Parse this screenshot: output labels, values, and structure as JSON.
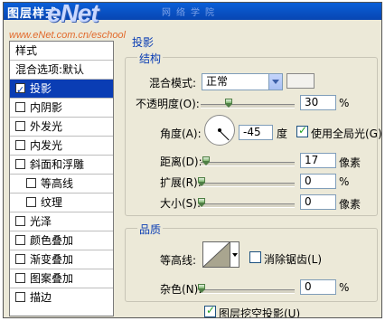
{
  "window": {
    "title": "图层样式"
  },
  "watermark": {
    "logo": "eNet",
    "cn": "网络学院",
    "url": "www.eNet.com.cn/eschool"
  },
  "sidebar": {
    "header": "样式",
    "blend_options": "混合选项:默认",
    "items": [
      {
        "label": "投影",
        "checked": true,
        "selected": true
      },
      {
        "label": "内阴影",
        "checked": false
      },
      {
        "label": "外发光",
        "checked": false
      },
      {
        "label": "内发光",
        "checked": false
      },
      {
        "label": "斜面和浮雕",
        "checked": false
      },
      {
        "label": "等高线",
        "checked": false
      },
      {
        "label": "纹理",
        "checked": false
      },
      {
        "label": "光泽",
        "checked": false
      },
      {
        "label": "颜色叠加",
        "checked": false
      },
      {
        "label": "渐变叠加",
        "checked": false
      },
      {
        "label": "图案叠加",
        "checked": false
      },
      {
        "label": "描边",
        "checked": false
      }
    ]
  },
  "panel": {
    "section_title": "投影",
    "structure": {
      "title": "结构",
      "blend_mode_label": "混合模式:",
      "blend_mode_value": "正常",
      "opacity_label": "不透明度(O):",
      "opacity_value": "30",
      "opacity_unit": "%",
      "opacity_level": 0.3,
      "angle_label": "角度(A):",
      "angle_value": "-45",
      "angle_unit": "度",
      "global_light_label": "使用全局光(G)",
      "global_light_checked": true,
      "distance_label": "距离(D):",
      "distance_value": "17",
      "distance_unit": "像素",
      "distance_level": 0.06,
      "spread_label": "扩展(R):",
      "spread_value": "0",
      "spread_unit": "%",
      "size_label": "大小(S):",
      "size_value": "0",
      "size_unit": "像素"
    },
    "quality": {
      "title": "品质",
      "contour_label": "等高线:",
      "antialias_label": "消除锯齿(L)",
      "antialias_checked": false,
      "noise_label": "杂色(N):",
      "noise_value": "0",
      "noise_unit": "%"
    },
    "knockout_label": "图层挖空投影(U)",
    "knockout_checked": true
  },
  "colors": {
    "titlebar": "#0846b2",
    "selection": "#0a3db4",
    "group_title": "#0a3db4",
    "dialog_bg": "#ece9d8"
  }
}
